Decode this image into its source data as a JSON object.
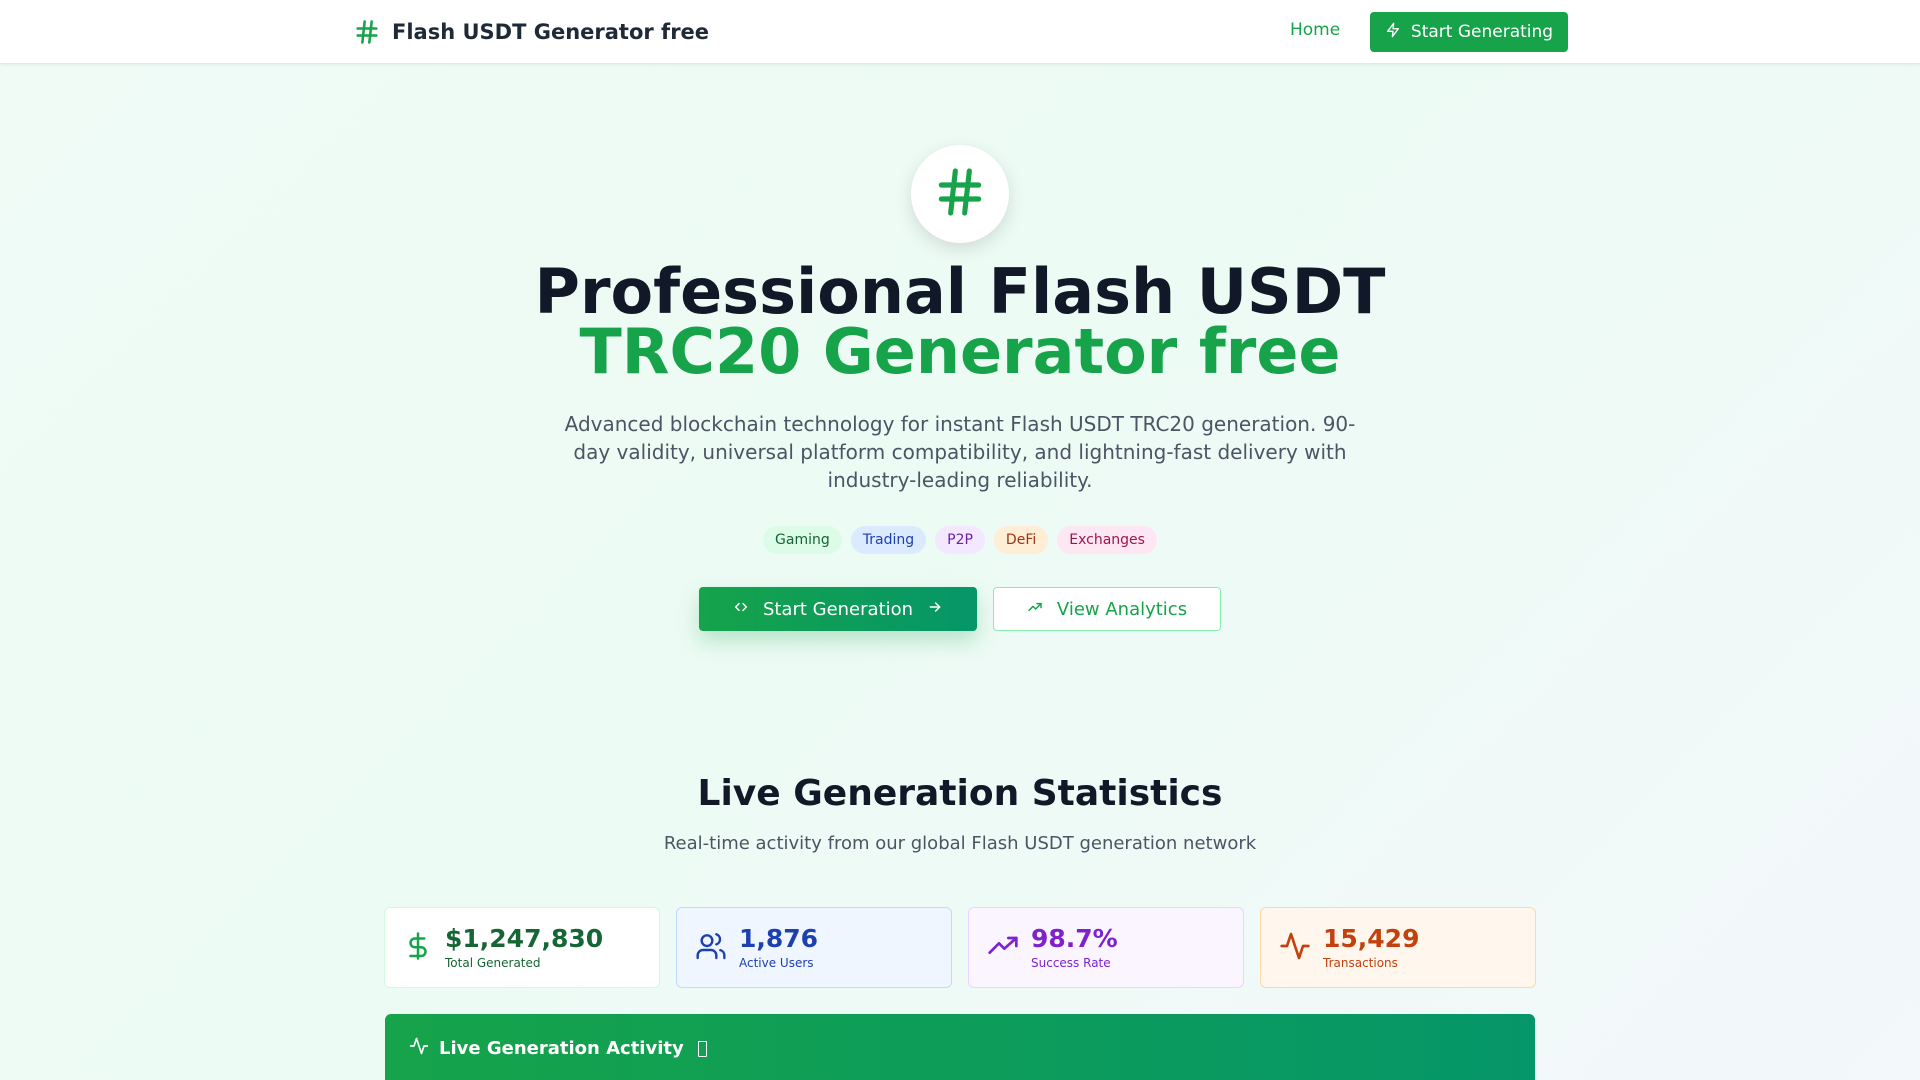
{
  "header": {
    "brand_title": "Flash USDT Generator free",
    "nav_home": "Home",
    "cta_label": "Start Generating"
  },
  "hero": {
    "title_line1": "Professional Flash USDT",
    "title_line2": "TRC20 Generator free",
    "description": "Advanced blockchain technology for instant Flash USDT TRC20 generation. 90-day validity, universal platform compatibility, and lightning-fast delivery with industry-leading reliability.",
    "tags": [
      "Gaming",
      "Trading",
      "P2P",
      "DeFi",
      "Exchanges"
    ],
    "primary_button": "Start Generation",
    "secondary_button": "View Analytics"
  },
  "stats": {
    "title": "Live Generation Statistics",
    "subtitle": "Real-time activity from our global Flash USDT generation network",
    "cards": [
      {
        "value": "$1,247,830",
        "label": "Total Generated",
        "icon": "dollar-icon"
      },
      {
        "value": "1,876",
        "label": "Active Users",
        "icon": "users-icon"
      },
      {
        "value": "98.7%",
        "label": "Success Rate",
        "icon": "trending-up-icon"
      },
      {
        "value": "15,429",
        "label": "Transactions",
        "icon": "activity-icon"
      }
    ]
  },
  "activity": {
    "title": "Live Generation Activity"
  },
  "colors": {
    "brand": "#16a34a",
    "blue": "#1e40af",
    "purple": "#7e22ce",
    "orange": "#c2410c"
  }
}
